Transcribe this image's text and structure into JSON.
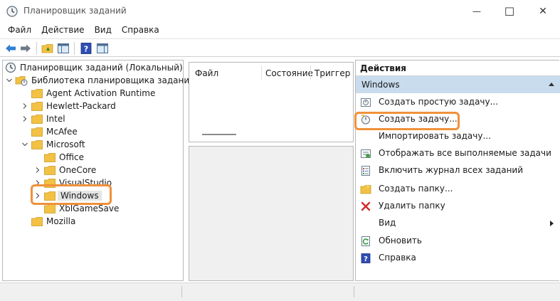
{
  "window": {
    "title": "Планировщик заданий",
    "minimize_glyph": "—",
    "maximize_glyph": "☐",
    "close_glyph": "✕"
  },
  "menu": [
    "Файл",
    "Действие",
    "Вид",
    "Справка"
  ],
  "toolbar": {
    "icons": [
      "back-icon",
      "forward-icon",
      "up-folder-icon",
      "show-hide-tree-icon",
      "help-icon",
      "action-pane-icon"
    ]
  },
  "tree": {
    "root": "Планировщик заданий (Локальный)",
    "library": "Библиотека планировщика заданий",
    "items": [
      {
        "label": "Agent Activation Runtime",
        "expandable": false
      },
      {
        "label": "Hewlett-Packard",
        "expandable": true
      },
      {
        "label": "Intel",
        "expandable": true
      },
      {
        "label": "McAfee",
        "expandable": false
      },
      {
        "label": "Microsoft",
        "expandable": true,
        "expanded": true
      }
    ],
    "microsoft_children": [
      {
        "label": "Office",
        "expandable": false
      },
      {
        "label": "OneCore",
        "expandable": true
      },
      {
        "label": "VisualStudio",
        "expandable": true
      },
      {
        "label": "Windows",
        "expandable": true,
        "selected": true
      },
      {
        "label": "XblGameSave",
        "expandable": false
      }
    ],
    "after": [
      {
        "label": "Mozilla",
        "expandable": false
      }
    ]
  },
  "task_list": {
    "columns": [
      "Файл",
      "Состояние",
      "Триггер"
    ]
  },
  "actions": {
    "title": "Действия",
    "group": "Windows",
    "items": [
      {
        "label": "Создать простую задачу...",
        "icon": "create-basic-task-icon"
      },
      {
        "label": "Создать задачу...",
        "icon": "create-task-icon",
        "highlighted": true
      },
      {
        "label": "Импортировать задачу...",
        "icon": ""
      },
      {
        "label": "Отображать все выполняемые задачи",
        "icon": "running-tasks-icon"
      },
      {
        "label": "Включить журнал всех заданий",
        "icon": "history-log-icon"
      },
      {
        "label": "Создать папку...",
        "icon": "new-folder-icon"
      },
      {
        "label": "Удалить папку",
        "icon": "delete-icon"
      },
      {
        "label": "Вид",
        "icon": "",
        "submenu": true
      },
      {
        "label": "Обновить",
        "icon": "refresh-icon"
      },
      {
        "label": "Справка",
        "icon": "help-icon"
      }
    ]
  },
  "colors": {
    "highlight": "#f0913a",
    "group_header": "#c9dcee",
    "selection": "#e5e5e5"
  }
}
